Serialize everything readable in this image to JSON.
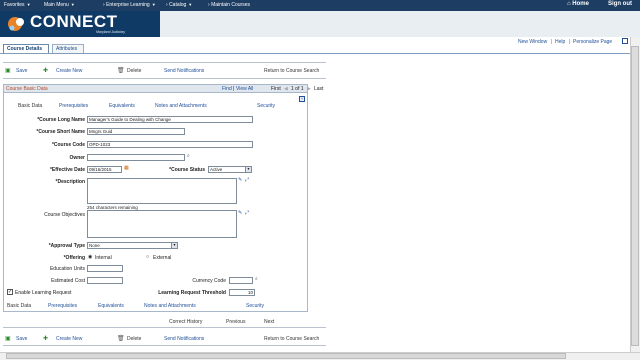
{
  "topbar": {
    "menus": [
      "Favorites",
      "Main Menu",
      "Enterprise Learning",
      "Catalog",
      "Maintain Courses"
    ],
    "home": "Home",
    "signout": "Sign out"
  },
  "brand": {
    "name": "CONNECT",
    "sub": "Maryland Judiciary"
  },
  "tabs": {
    "course_details": "Course Details",
    "attributes": "Attributes"
  },
  "toplinks": {
    "new_window": "New Window",
    "help": "Help",
    "personalize": "Personalize Page"
  },
  "toolbar": {
    "save": "Save",
    "create_new": "Create New",
    "delete": "Delete",
    "send_notifications": "Send Notifications",
    "return": "Return to Course Search"
  },
  "panel": {
    "title": "Course Basic Data",
    "find": "Find",
    "view_all": "View All",
    "first": "First",
    "pager": "1 of 1",
    "last": "Last"
  },
  "pagetabs": [
    "Basic Data",
    "Prerequisites",
    "Equivalents",
    "Notes and Attachments",
    "Security"
  ],
  "form": {
    "long_name_label": "*Course Long Name",
    "long_name_value": "Manager's Guide to Dealing with Change",
    "short_name_label": "*Course Short Name",
    "short_name_value": "Mngrs Guid",
    "code_label": "*Course Code",
    "code_value": "OPD-1023",
    "owner_label": "Owner",
    "eff_date_label": "*Effective Date",
    "eff_date_value": "09/16/2015",
    "status_label": "*Course Status",
    "status_value": "Active",
    "description_label": "*Description",
    "chars_remaining": "254 characters remaining",
    "objectives_label": "Course Objectives",
    "approval_label": "*Approval Type",
    "approval_value": "None",
    "offering_label": "*Offering",
    "offering_internal": "Internal",
    "offering_external": "External",
    "edu_units_label": "Education Units",
    "est_cost_label": "Estimated Cost",
    "currency_label": "Currency Code",
    "enable_lr_label": "Enable Learning Request",
    "lr_threshold_label": "Learning Request Threshold",
    "lr_threshold_value": "10"
  },
  "nav": {
    "correct_history": "Correct History",
    "previous": "Previous",
    "next": "Next"
  }
}
